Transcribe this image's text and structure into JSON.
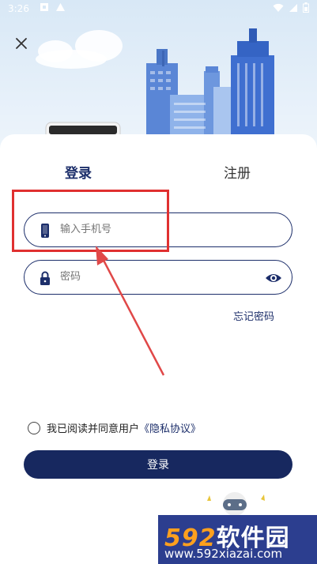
{
  "status_bar": {
    "time": "3:26",
    "left_icons": [
      "notification-icon",
      "warning-icon"
    ],
    "right_icons": [
      "wifi-icon",
      "signal-icon",
      "battery-icon"
    ]
  },
  "header": {
    "close_icon": "close-icon"
  },
  "tabs": [
    {
      "label": "登录",
      "active": true
    },
    {
      "label": "注册",
      "active": false
    }
  ],
  "form": {
    "phone_placeholder": "输入手机号",
    "password_placeholder": "密码",
    "forgot_password": "忘记密码"
  },
  "agreement": {
    "text": "我已阅读并同意用户",
    "link": "《隐私协议》",
    "checked": false
  },
  "login_button": "登录",
  "watermark": {
    "number": "592",
    "name": "软件园",
    "url": "www.592xiazai.com"
  },
  "colors": {
    "brand": "#17285f",
    "annotation": "#e03030",
    "watermark_bg": "#2c3e8f"
  }
}
